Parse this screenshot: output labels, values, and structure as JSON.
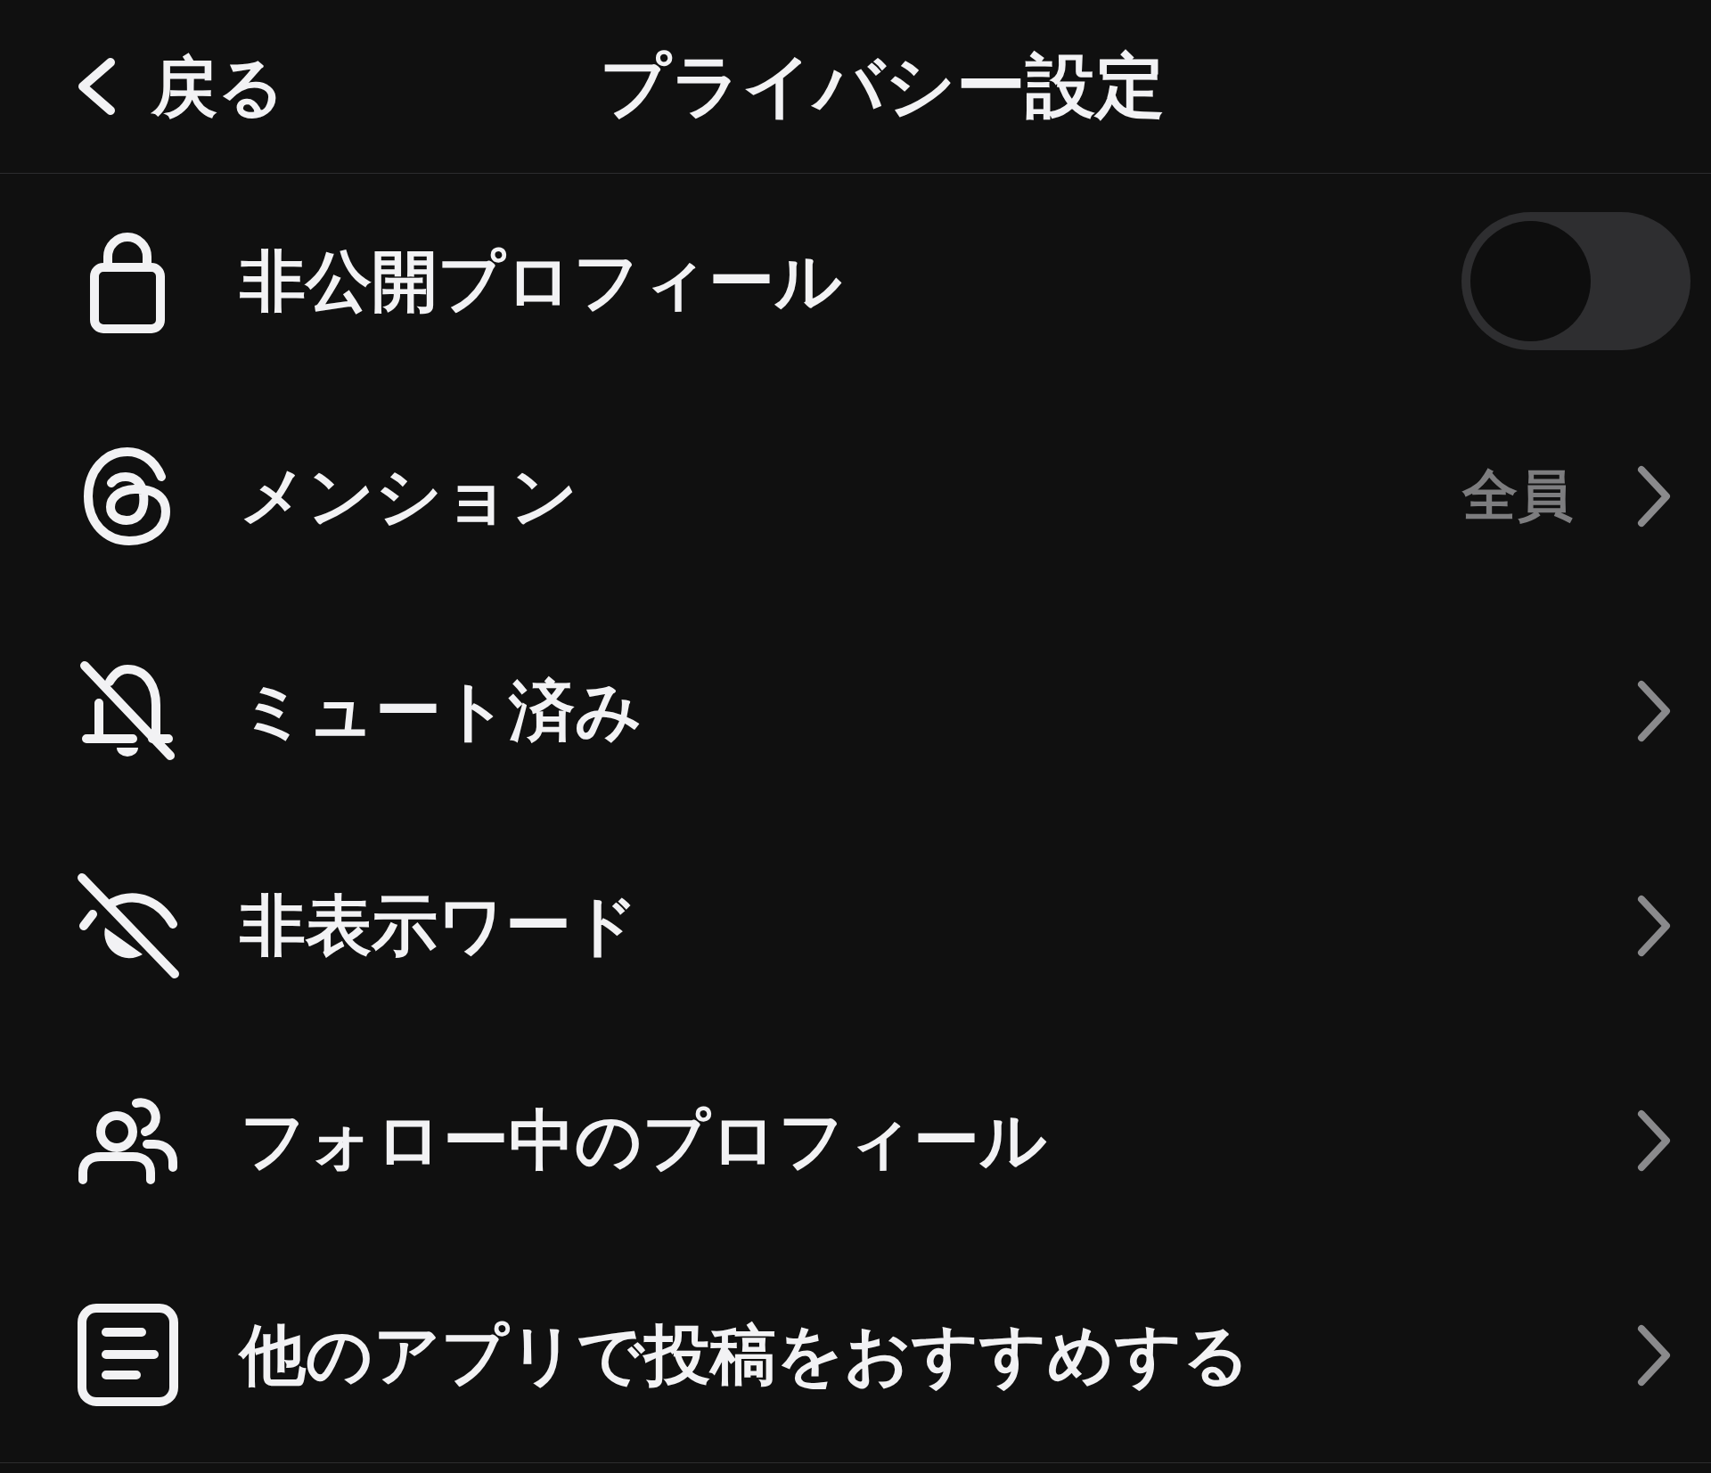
{
  "header": {
    "back_label": "戻る",
    "title": "プライバシー設定"
  },
  "items": [
    {
      "kind": "toggle",
      "label": "非公開プロフィール",
      "on": false
    },
    {
      "kind": "link",
      "label": "メンション",
      "value": "全員"
    },
    {
      "kind": "link",
      "label": "ミュート済み"
    },
    {
      "kind": "link",
      "label": "非表示ワード"
    },
    {
      "kind": "link",
      "label": "フォロー中のプロフィール"
    },
    {
      "kind": "link",
      "label": "他のアプリで投稿をおすすめする"
    }
  ]
}
